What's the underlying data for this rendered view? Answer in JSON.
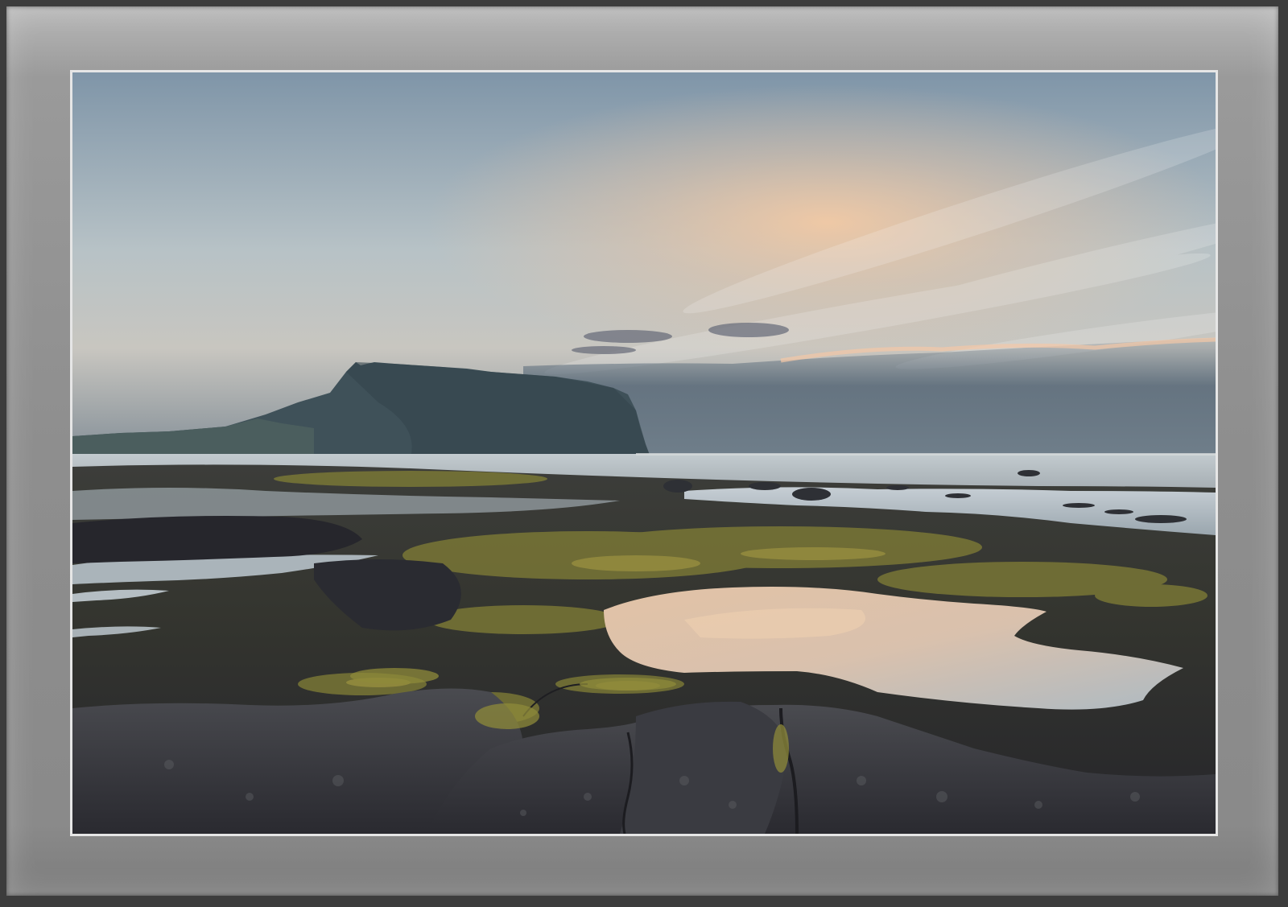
{
  "scene": {
    "subject": "seascape",
    "colors": {
      "sky_top": "#7f95a8",
      "sky_mid": "#b7c2c6",
      "sky_glow": "#f2c9a4",
      "cloud_band": "#5f6f7e",
      "mountain": "#3f5159",
      "sea": "#c9cfd2",
      "tidepool": "#e8c7a8",
      "rock_dark": "#2c2d33",
      "moss": "#8c8a3a",
      "mat": "#8e8e8e",
      "photo_border": "#e6e6e6"
    }
  }
}
